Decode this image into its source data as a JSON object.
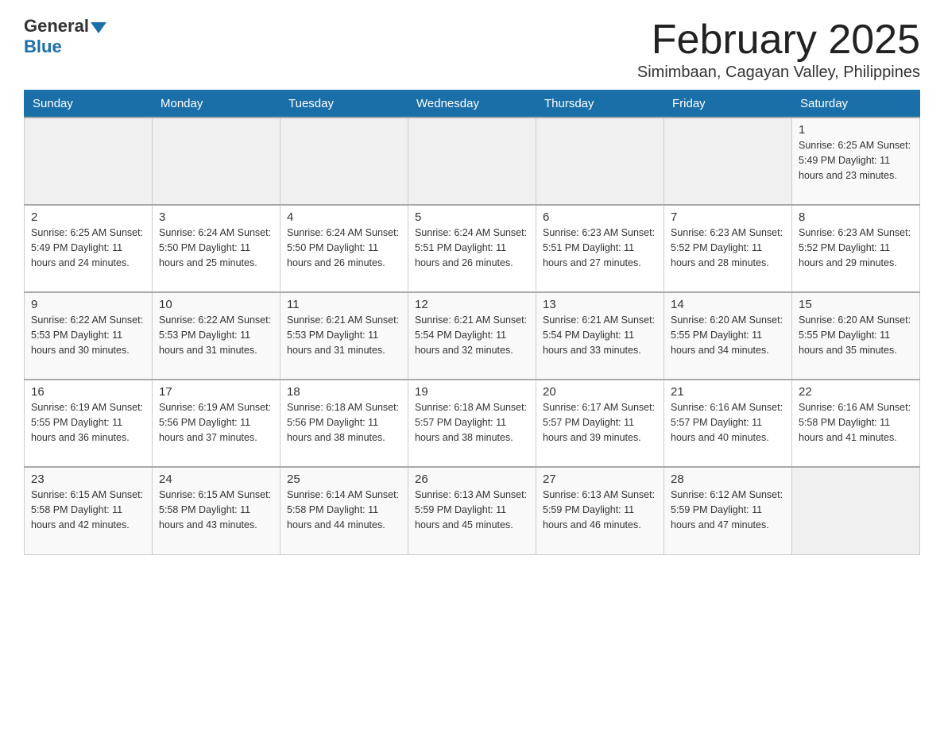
{
  "header": {
    "logo_general": "General",
    "logo_blue": "Blue",
    "month_title": "February 2025",
    "subtitle": "Simimbaan, Cagayan Valley, Philippines"
  },
  "days_of_week": [
    "Sunday",
    "Monday",
    "Tuesday",
    "Wednesday",
    "Thursday",
    "Friday",
    "Saturday"
  ],
  "weeks": [
    [
      {
        "day": "",
        "info": ""
      },
      {
        "day": "",
        "info": ""
      },
      {
        "day": "",
        "info": ""
      },
      {
        "day": "",
        "info": ""
      },
      {
        "day": "",
        "info": ""
      },
      {
        "day": "",
        "info": ""
      },
      {
        "day": "1",
        "info": "Sunrise: 6:25 AM\nSunset: 5:49 PM\nDaylight: 11 hours\nand 23 minutes."
      }
    ],
    [
      {
        "day": "2",
        "info": "Sunrise: 6:25 AM\nSunset: 5:49 PM\nDaylight: 11 hours\nand 24 minutes."
      },
      {
        "day": "3",
        "info": "Sunrise: 6:24 AM\nSunset: 5:50 PM\nDaylight: 11 hours\nand 25 minutes."
      },
      {
        "day": "4",
        "info": "Sunrise: 6:24 AM\nSunset: 5:50 PM\nDaylight: 11 hours\nand 26 minutes."
      },
      {
        "day": "5",
        "info": "Sunrise: 6:24 AM\nSunset: 5:51 PM\nDaylight: 11 hours\nand 26 minutes."
      },
      {
        "day": "6",
        "info": "Sunrise: 6:23 AM\nSunset: 5:51 PM\nDaylight: 11 hours\nand 27 minutes."
      },
      {
        "day": "7",
        "info": "Sunrise: 6:23 AM\nSunset: 5:52 PM\nDaylight: 11 hours\nand 28 minutes."
      },
      {
        "day": "8",
        "info": "Sunrise: 6:23 AM\nSunset: 5:52 PM\nDaylight: 11 hours\nand 29 minutes."
      }
    ],
    [
      {
        "day": "9",
        "info": "Sunrise: 6:22 AM\nSunset: 5:53 PM\nDaylight: 11 hours\nand 30 minutes."
      },
      {
        "day": "10",
        "info": "Sunrise: 6:22 AM\nSunset: 5:53 PM\nDaylight: 11 hours\nand 31 minutes."
      },
      {
        "day": "11",
        "info": "Sunrise: 6:21 AM\nSunset: 5:53 PM\nDaylight: 11 hours\nand 31 minutes."
      },
      {
        "day": "12",
        "info": "Sunrise: 6:21 AM\nSunset: 5:54 PM\nDaylight: 11 hours\nand 32 minutes."
      },
      {
        "day": "13",
        "info": "Sunrise: 6:21 AM\nSunset: 5:54 PM\nDaylight: 11 hours\nand 33 minutes."
      },
      {
        "day": "14",
        "info": "Sunrise: 6:20 AM\nSunset: 5:55 PM\nDaylight: 11 hours\nand 34 minutes."
      },
      {
        "day": "15",
        "info": "Sunrise: 6:20 AM\nSunset: 5:55 PM\nDaylight: 11 hours\nand 35 minutes."
      }
    ],
    [
      {
        "day": "16",
        "info": "Sunrise: 6:19 AM\nSunset: 5:55 PM\nDaylight: 11 hours\nand 36 minutes."
      },
      {
        "day": "17",
        "info": "Sunrise: 6:19 AM\nSunset: 5:56 PM\nDaylight: 11 hours\nand 37 minutes."
      },
      {
        "day": "18",
        "info": "Sunrise: 6:18 AM\nSunset: 5:56 PM\nDaylight: 11 hours\nand 38 minutes."
      },
      {
        "day": "19",
        "info": "Sunrise: 6:18 AM\nSunset: 5:57 PM\nDaylight: 11 hours\nand 38 minutes."
      },
      {
        "day": "20",
        "info": "Sunrise: 6:17 AM\nSunset: 5:57 PM\nDaylight: 11 hours\nand 39 minutes."
      },
      {
        "day": "21",
        "info": "Sunrise: 6:16 AM\nSunset: 5:57 PM\nDaylight: 11 hours\nand 40 minutes."
      },
      {
        "day": "22",
        "info": "Sunrise: 6:16 AM\nSunset: 5:58 PM\nDaylight: 11 hours\nand 41 minutes."
      }
    ],
    [
      {
        "day": "23",
        "info": "Sunrise: 6:15 AM\nSunset: 5:58 PM\nDaylight: 11 hours\nand 42 minutes."
      },
      {
        "day": "24",
        "info": "Sunrise: 6:15 AM\nSunset: 5:58 PM\nDaylight: 11 hours\nand 43 minutes."
      },
      {
        "day": "25",
        "info": "Sunrise: 6:14 AM\nSunset: 5:58 PM\nDaylight: 11 hours\nand 44 minutes."
      },
      {
        "day": "26",
        "info": "Sunrise: 6:13 AM\nSunset: 5:59 PM\nDaylight: 11 hours\nand 45 minutes."
      },
      {
        "day": "27",
        "info": "Sunrise: 6:13 AM\nSunset: 5:59 PM\nDaylight: 11 hours\nand 46 minutes."
      },
      {
        "day": "28",
        "info": "Sunrise: 6:12 AM\nSunset: 5:59 PM\nDaylight: 11 hours\nand 47 minutes."
      },
      {
        "day": "",
        "info": ""
      }
    ]
  ]
}
